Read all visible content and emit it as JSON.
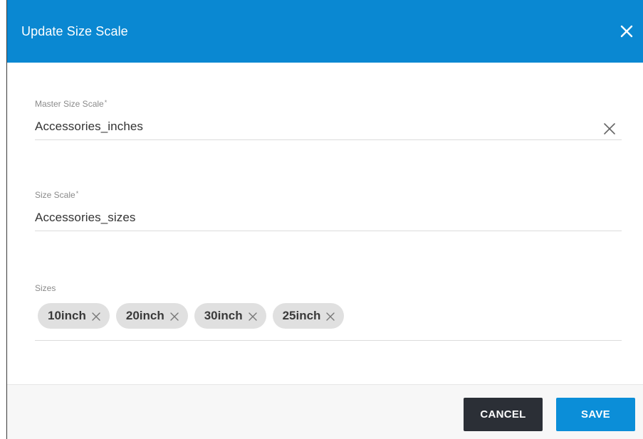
{
  "dialog": {
    "title": "Update Size Scale"
  },
  "fields": {
    "master_size_scale": {
      "label": "Master Size Scale",
      "required_mark": "*",
      "value": "Accessories_inches"
    },
    "size_scale": {
      "label": "Size Scale",
      "required_mark": "*",
      "value": "Accessories_sizes"
    },
    "sizes": {
      "label": "Sizes",
      "chips": [
        {
          "label": "10inch"
        },
        {
          "label": "20inch"
        },
        {
          "label": "30inch"
        },
        {
          "label": "25inch"
        }
      ]
    }
  },
  "footer": {
    "cancel_label": "CANCEL",
    "save_label": "SAVE"
  },
  "colors": {
    "header_bg": "#0a88d2",
    "cancel_bg": "#2b2f36",
    "save_bg": "#0b8ed8",
    "chip_bg": "#e0e0e0"
  },
  "icons": {
    "dialog_close": "close-icon",
    "field_clear": "clear-icon",
    "chip_remove": "remove-chip-icon"
  }
}
